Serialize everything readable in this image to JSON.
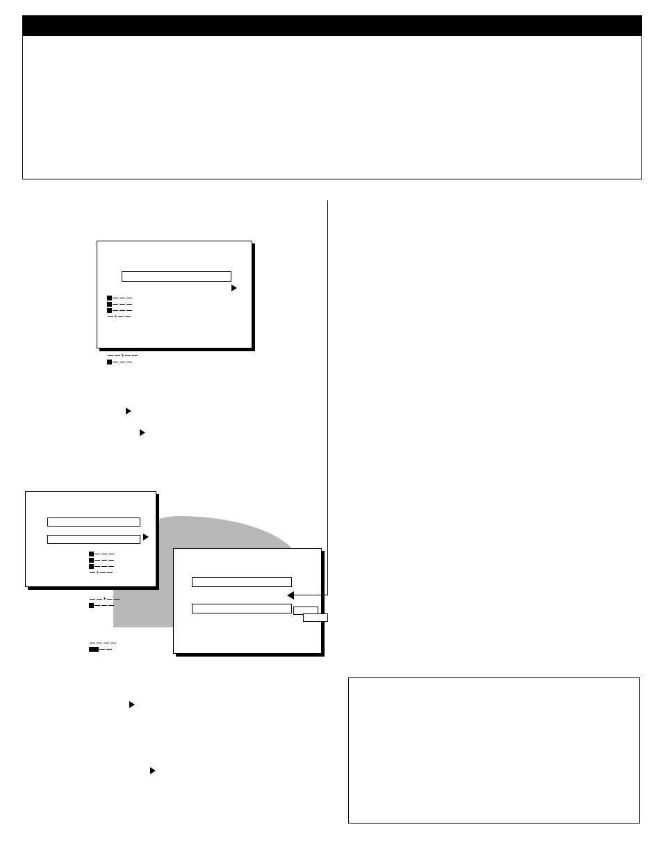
{
  "header": {
    "title": ""
  },
  "intro": {
    "text": ""
  },
  "screens": {
    "screen1": {
      "label": ""
    },
    "screen2": {
      "bar1": "",
      "bar2": ""
    },
    "screen3": {
      "bar1": "",
      "bar2": "",
      "option1": "",
      "option2": ""
    }
  },
  "note": {
    "text": ""
  }
}
